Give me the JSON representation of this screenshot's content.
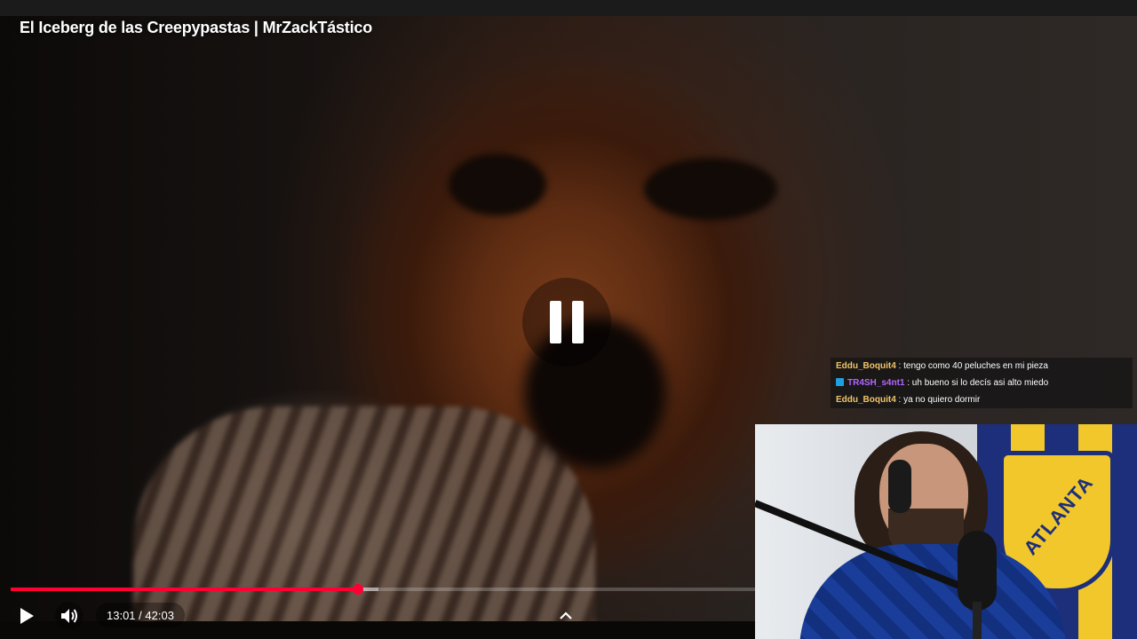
{
  "player": {
    "title": "El Iceberg de las Creepypastas | MrZackTástico",
    "current_time": "13:01",
    "duration": "42:03",
    "played_fraction": 0.4667,
    "buffered_fraction": 0.4945,
    "accent": "#ff0033",
    "center_icon": "pause-icon"
  },
  "chat": {
    "messages": [
      {
        "user": "Eddu_Boquit4",
        "text": " : tengo como 40 peluches en mi pieza",
        "color": "#f0c46a",
        "badge": false
      },
      {
        "user": "TR4SH_s4nt1",
        "text": " : uh bueno si lo decís asi alto miedo",
        "color": "#b366ff",
        "badge": true
      },
      {
        "user": "Eddu_Boquit4",
        "text": " : ya no quiero dormir",
        "color": "#f0c46a",
        "badge": false
      }
    ]
  },
  "webcam": {
    "flag_text": "ATLANTA"
  }
}
